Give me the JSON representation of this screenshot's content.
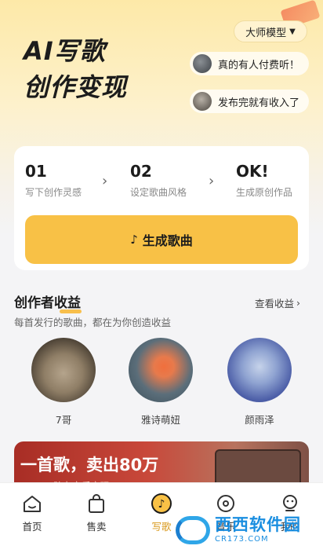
{
  "hero": {
    "title_line1": "AI写歌",
    "title_line2": "创作变现",
    "model_select": "大师模型",
    "bubbles": [
      {
        "text": "真的有人付费听！"
      },
      {
        "text": "发布完就有收入了"
      }
    ]
  },
  "steps": [
    {
      "num": "01",
      "desc": "写下创作灵感"
    },
    {
      "num": "02",
      "desc": "设定歌曲风格"
    },
    {
      "num": "OK!",
      "desc": "生成原创作品"
    }
  ],
  "generate_button": "生成歌曲",
  "earnings": {
    "title": "创作者收益",
    "view_link": "查看收益",
    "subtitle": "每首发行的歌曲，都在为你创造收益",
    "creators": [
      {
        "name": "7哥"
      },
      {
        "name": "雅诗萌妞"
      },
      {
        "name": "颜雨泽"
      }
    ]
  },
  "banner": {
    "title": "一首歌，卖出80万",
    "subtitle": "AI助力音乐变现"
  },
  "tabbar": {
    "items": [
      {
        "label": "首页"
      },
      {
        "label": "售卖"
      },
      {
        "label": "写歌"
      },
      {
        "label": "音乐"
      },
      {
        "label": "我的"
      }
    ],
    "active_color": "#d99a1e"
  },
  "watermark": {
    "text": "西西软件园",
    "url": "CR173.COM"
  },
  "colors": {
    "accent": "#f8c146",
    "hero_bg": "#fde9a8"
  }
}
